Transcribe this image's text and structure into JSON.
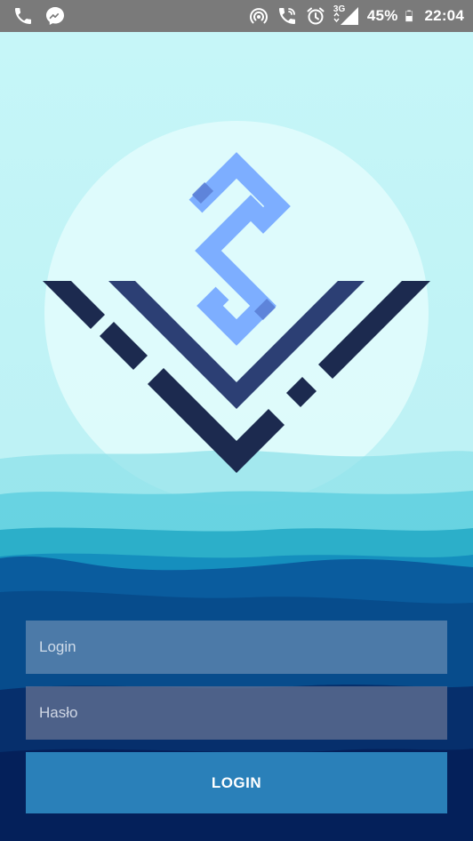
{
  "status_bar": {
    "battery": "45%",
    "time": "22:04",
    "network": "3G",
    "icons_left": [
      "phone-icon",
      "messenger-icon"
    ],
    "icons_right": [
      "hotspot-icon",
      "wifi-call-icon",
      "alarm-icon",
      "signal-icon",
      "battery-icon"
    ]
  },
  "logo": {
    "icon": "sv-logo",
    "colors": {
      "s_mark": "#7daeff",
      "v_inner": "#2c3f74",
      "v_outer": "#1c2a4f",
      "circle": "#e0fbfc"
    }
  },
  "form": {
    "login_placeholder": "Login",
    "password_placeholder": "Hasło",
    "submit_label": "LOGIN"
  },
  "colors": {
    "sky": "#c3f5f7",
    "button": "#2a80b9"
  }
}
